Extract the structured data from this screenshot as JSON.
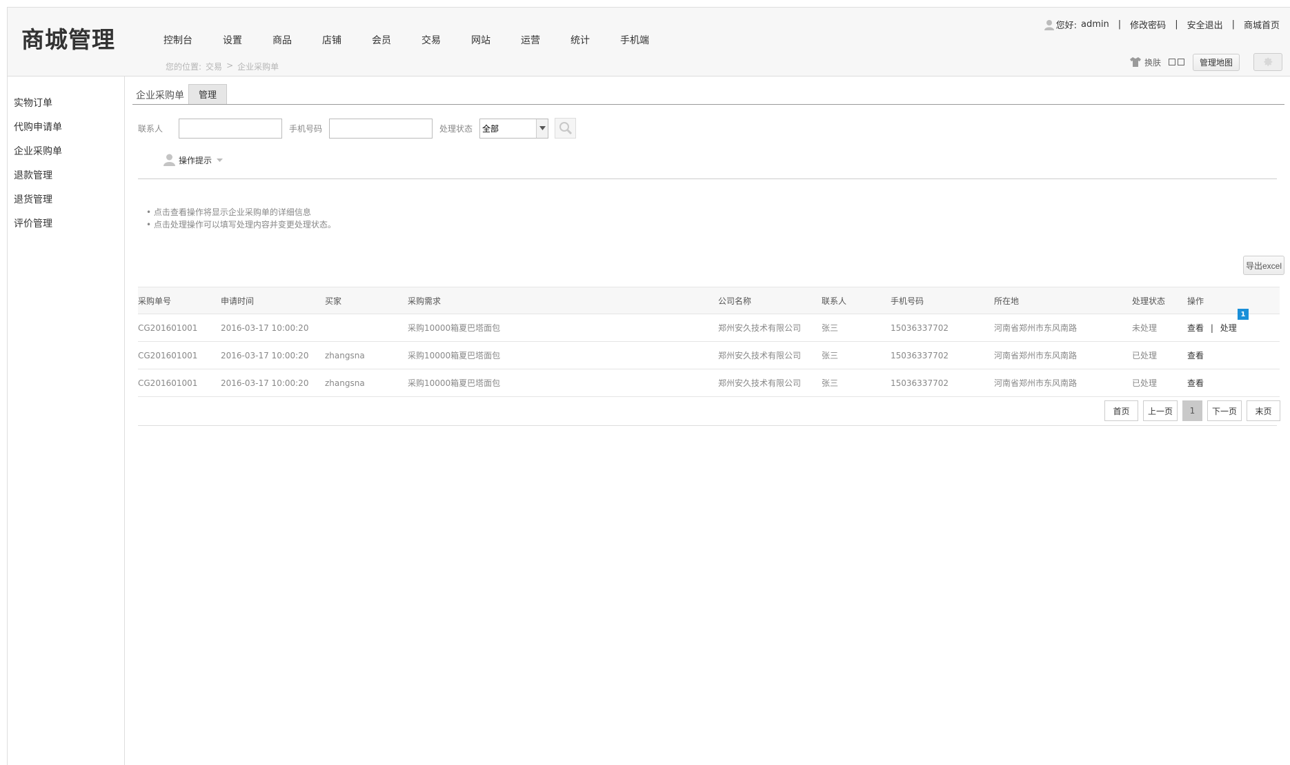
{
  "header": {
    "logo": "商城管理",
    "nav": [
      "控制台",
      "设置",
      "商品",
      "店铺",
      "会员",
      "交易",
      "网站",
      "运营",
      "统计",
      "手机端"
    ],
    "breadcrumb": {
      "prefix": "您的位置:",
      "level1": "交易",
      "sep": ">",
      "level2": "企业采购单"
    },
    "user": {
      "greeting": "您好:",
      "name": "admin",
      "change_password": "修改密码",
      "logout": "安全退出",
      "home": "商城首页",
      "separator": "|"
    },
    "skin_label": "换肤",
    "sitemap_button": "管理地图"
  },
  "sidebar": {
    "items": [
      "实物订单",
      "代购申请单",
      "企业采购单",
      "退款管理",
      "退货管理",
      "评价管理"
    ]
  },
  "main": {
    "tab_title": "企业采购单",
    "tab_active": "管理",
    "filters": {
      "contact_label": "联系人",
      "contact_value": "",
      "phone_label": "手机号码",
      "phone_value": "",
      "status_label": "处理状态",
      "status_value": "全部"
    },
    "hint_title": "操作提示",
    "hints": [
      "点击查看操作将显示企业采购单的详细信息",
      "点击处理操作可以填写处理内容并变更处理状态。"
    ],
    "export_button": "导出excel",
    "table": {
      "columns": [
        "采购单号",
        "申请时间",
        "买家",
        "采购需求",
        "公司名称",
        "联系人",
        "手机号码",
        "所在地",
        "处理状态",
        "操作"
      ],
      "rows": [
        {
          "id": "CG201601001",
          "time": "2016-03-17 10:00:20",
          "buyer": "",
          "need": "采购10000箱夏巴塔面包",
          "company": "郑州安久技术有限公司",
          "contact": "张三",
          "phone": "15036337702",
          "location": "河南省郑州市东风南路",
          "status": "未处理",
          "view": "查看",
          "sep": "|",
          "process": "处理"
        },
        {
          "id": "CG201601001",
          "time": "2016-03-17 10:00:20",
          "buyer": "zhangsna",
          "need": "采购10000箱夏巴塔面包",
          "company": "郑州安久技术有限公司",
          "contact": "张三",
          "phone": "15036337702",
          "location": "河南省郑州市东风南路",
          "status": "已处理",
          "view": "查看"
        },
        {
          "id": "CG201601001",
          "time": "2016-03-17 10:00:20",
          "buyer": "zhangsna",
          "need": "采购10000箱夏巴塔面包",
          "company": "郑州安久技术有限公司",
          "contact": "张三",
          "phone": "15036337702",
          "location": "河南省郑州市东风南路",
          "status": "已处理",
          "view": "查看"
        }
      ],
      "badge": "1"
    },
    "pager": {
      "first": "首页",
      "prev": "上一页",
      "current": "1",
      "next": "下一页",
      "last": "末页"
    }
  },
  "colors": {
    "badge": "#1a8fd8",
    "border": "#dddddd",
    "muted_text": "#888888"
  }
}
